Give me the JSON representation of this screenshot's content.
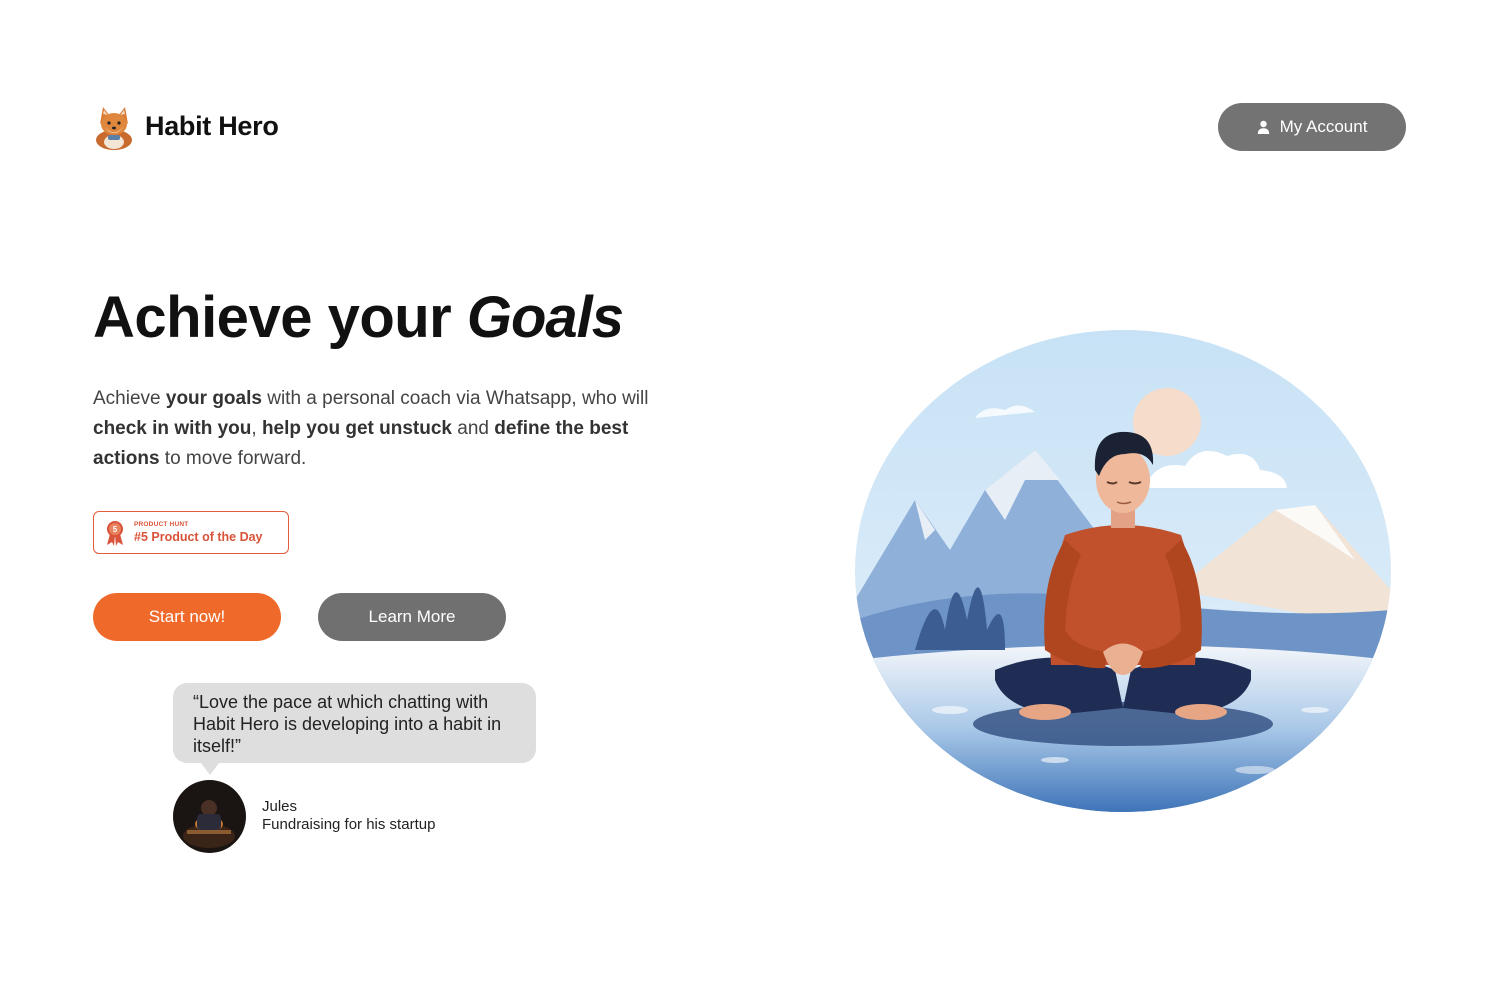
{
  "header": {
    "brand_name": "Habit Hero",
    "logo_icon": "fox-mascot-icon",
    "account_button": "My Account",
    "account_icon": "user-icon"
  },
  "hero": {
    "title_plain": "Achieve your ",
    "title_emphasis": "Goals",
    "description": [
      {
        "text": "Achieve ",
        "bold": false
      },
      {
        "text": "your goals",
        "bold": true
      },
      {
        "text": " with a personal coach via Whatsapp, who will ",
        "bold": false
      },
      {
        "text": "check in with you",
        "bold": true
      },
      {
        "text": ", ",
        "bold": false
      },
      {
        "text": "help you get unstuck",
        "bold": true
      },
      {
        "text": " and ",
        "bold": false
      },
      {
        "text": "define the best actions",
        "bold": true
      },
      {
        "text": " to move forward.",
        "bold": false
      }
    ]
  },
  "badge": {
    "small_label": "PRODUCT HUNT",
    "main_label": "#5 Product of the Day",
    "medal_number": "5",
    "color": "#d9533a"
  },
  "cta": {
    "primary": "Start now!",
    "secondary": "Learn More",
    "primary_color": "#ef6a2a",
    "secondary_color": "#707070"
  },
  "testimonial": {
    "quote": "“Love the pace at which chatting with Habit Hero is developing into a habit in itself!”",
    "author_name": "Jules",
    "author_role": "Fundraising for his startup"
  },
  "illustration": {
    "icon": "meditating-man-illustration"
  }
}
